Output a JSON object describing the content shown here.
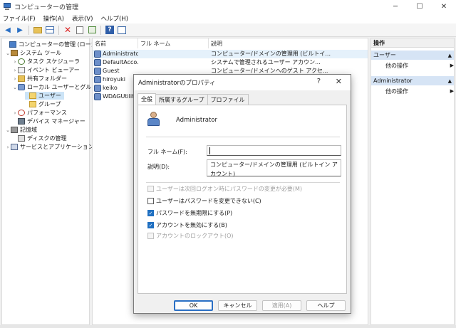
{
  "window": {
    "title": "コンピューターの管理",
    "controls": [
      "─",
      "☐",
      "✕"
    ]
  },
  "menu": [
    "ファイル(F)",
    "操作(A)",
    "表示(V)",
    "ヘルプ(H)"
  ],
  "tree": {
    "root": "コンピューターの管理 (ローカル)",
    "system_tools": "システム ツール",
    "task_scheduler": "タスク スケジューラ",
    "event_viewer": "イベント ビューアー",
    "shared_folders": "共有フォルダー",
    "local_users": "ローカル ユーザーとグループ",
    "users": "ユーザー",
    "groups": "グループ",
    "performance": "パフォーマンス",
    "device_manager": "デバイス マネージャー",
    "storage": "記憶域",
    "disk_management": "ディスクの管理",
    "services_apps": "サービスとアプリケーション"
  },
  "list": {
    "headers": [
      "名前",
      "フル ネーム",
      "説明"
    ],
    "rows": [
      {
        "name": "Administrator",
        "fullname": "",
        "desc": "コンピューター/ドメインの管理用 (ビルトイ..."
      },
      {
        "name": "DefaultAcco...",
        "fullname": "",
        "desc": "システムで管理されるユーザー アカウン..."
      },
      {
        "name": "Guest",
        "fullname": "",
        "desc": "コンピューター/ドメインへのゲスト アクセ..."
      },
      {
        "name": "hiroyuki",
        "fullname": "",
        "desc": ""
      },
      {
        "name": "keiko",
        "fullname": "",
        "desc": ""
      },
      {
        "name": "WDAGUtility...",
        "fullname": "",
        "desc": ""
      }
    ]
  },
  "actions": {
    "title": "操作",
    "group1": "ユーザー",
    "group1_item": "他の操作",
    "group2": "Administrator",
    "group2_item": "他の操作"
  },
  "dialog": {
    "title": "Administratorのプロパティ",
    "help": "?",
    "close": "✕",
    "tabs": [
      "全般",
      "所属するグループ",
      "プロファイル"
    ],
    "username": "Administrator",
    "fullname_label": "フル ネーム(F):",
    "fullname_value": "",
    "desc_label": "説明(D):",
    "desc_value": "コンピューター/ドメインの管理用 (ビルトイン アカウント)",
    "checkboxes": [
      {
        "label": "ユーザーは次回ログオン時にパスワードの変更が必要(M)",
        "checked": false,
        "disabled": true
      },
      {
        "label": "ユーザーはパスワードを変更できない(C)",
        "checked": false,
        "disabled": false
      },
      {
        "label": "パスワードを無期限にする(P)",
        "checked": true,
        "disabled": false
      },
      {
        "label": "アカウントを無効にする(B)",
        "checked": true,
        "disabled": false
      },
      {
        "label": "アカウントのロックアウト(O)",
        "checked": false,
        "disabled": true
      }
    ],
    "buttons": {
      "ok": "OK",
      "cancel": "キャンセル",
      "apply": "適用(A)",
      "help": "ヘルプ"
    }
  }
}
